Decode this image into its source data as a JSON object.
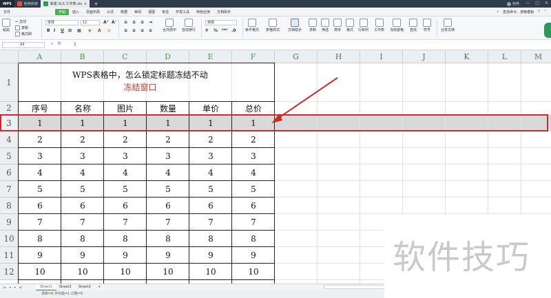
{
  "titlebar": {
    "app": "WPS",
    "tabs": [
      "稻壳商城",
      "新建 XLS 工作表.xls"
    ],
    "user": "稻壳"
  },
  "menubar": {
    "file": "文件",
    "items": [
      "开始",
      "插入",
      "页面布局",
      "公式",
      "数据",
      "审阅",
      "视图",
      "安全",
      "开发工具",
      "特色应用",
      "文档助手"
    ],
    "search": "查找命令、搜索模板"
  },
  "ribbon": {
    "paste": "粘贴",
    "cut": "剪切",
    "copy": "复制",
    "format_painter": "格式刷",
    "font": "宋体",
    "size": "12",
    "merge": "合并居中",
    "wrap": "自动换行",
    "number_format": "常规",
    "cond_format": "条件格式",
    "table_style": "表格样式",
    "doc_helper": "文档助手",
    "sum": "求和",
    "filter": "筛选",
    "sort": "排序",
    "format": "格式",
    "rowcol": "行和列",
    "sheet": "工作表",
    "freeze": "冻结窗格",
    "find": "查找",
    "symbol": "符号",
    "share": "分享文档"
  },
  "formula": {
    "cell_ref": "A3",
    "value": "1"
  },
  "columns": [
    "A",
    "B",
    "C",
    "D",
    "E",
    "F",
    "G",
    "H",
    "I",
    "J",
    "K",
    "L",
    "M"
  ],
  "rows": [
    "1",
    "2",
    "3",
    "4",
    "5",
    "6",
    "7",
    "8",
    "9",
    "10",
    "11",
    "12"
  ],
  "sheet_title": {
    "line1": "WPS表格中，怎么锁定标题冻结不动",
    "line2": "冻结窗口"
  },
  "table": {
    "headers": [
      "序号",
      "名称",
      "图片",
      "数量",
      "单价",
      "总价"
    ],
    "rows": [
      [
        "1",
        "1",
        "1",
        "1",
        "1",
        "1"
      ],
      [
        "2",
        "2",
        "2",
        "2",
        "2",
        "2"
      ],
      [
        "3",
        "3",
        "3",
        "3",
        "3",
        "3"
      ],
      [
        "4",
        "4",
        "4",
        "4",
        "4",
        "4"
      ],
      [
        "5",
        "5",
        "5",
        "5",
        "5",
        "5"
      ],
      [
        "6",
        "6",
        "6",
        "6",
        "6",
        "6"
      ],
      [
        "7",
        "7",
        "7",
        "7",
        "7",
        "7"
      ],
      [
        "8",
        "8",
        "8",
        "8",
        "8",
        "8"
      ],
      [
        "9",
        "9",
        "9",
        "9",
        "9",
        "9"
      ],
      [
        "10",
        "10",
        "10",
        "10",
        "10",
        "10"
      ]
    ]
  },
  "sheets": [
    "Sheet1",
    "Sheet2",
    "Sheet3"
  ],
  "status": "求和=6  平均值=1  计数=6",
  "watermark": "软件技巧",
  "colors": {
    "highlight_border": "#cc2a2a",
    "frozen_row": "#d9d9d9",
    "accent": "#4caf50"
  }
}
